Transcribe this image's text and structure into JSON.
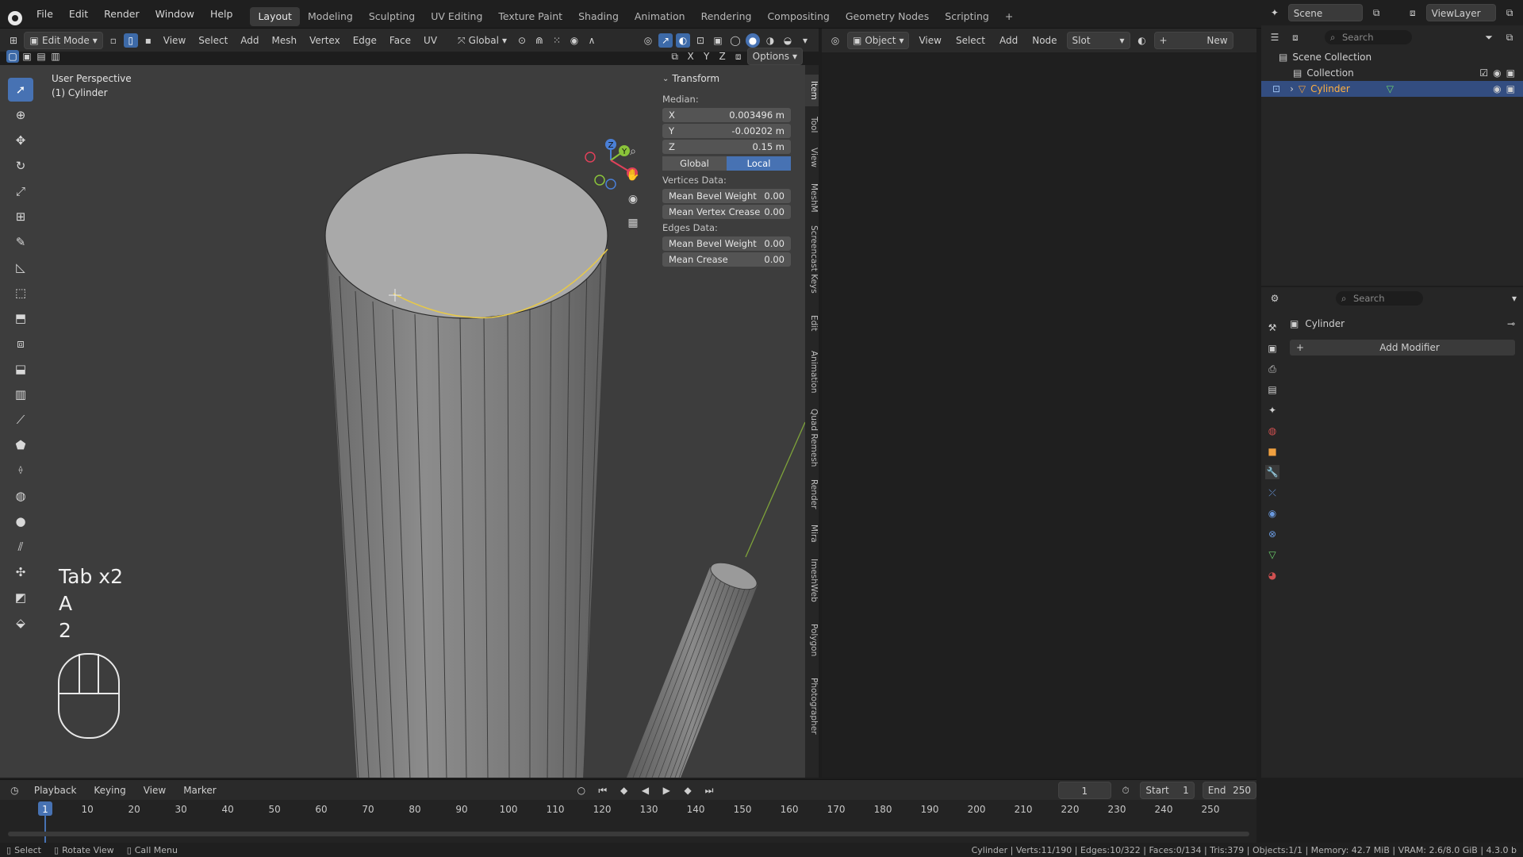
{
  "topbar": {
    "menus": [
      "File",
      "Edit",
      "Render",
      "Window",
      "Help"
    ],
    "workspaces": [
      "Layout",
      "Modeling",
      "Sculpting",
      "UV Editing",
      "Texture Paint",
      "Shading",
      "Animation",
      "Rendering",
      "Compositing",
      "Geometry Nodes",
      "Scripting"
    ],
    "active_workspace": "Layout",
    "scene": "Scene",
    "view_layer": "ViewLayer"
  },
  "viewport_header": {
    "mode": "Edit Mode",
    "menus": [
      "View",
      "Select",
      "Add",
      "Mesh",
      "Vertex",
      "Edge",
      "Face",
      "UV"
    ],
    "orientation": "Global",
    "options": "Options",
    "axes": [
      "X",
      "Y",
      "Z"
    ]
  },
  "viewport": {
    "view_name": "User Perspective",
    "object_name": "(1) Cylinder",
    "gizmo_labels": [
      "Z",
      "Y",
      "X"
    ],
    "keys": [
      "Tab x2",
      "A",
      "2"
    ]
  },
  "transform_panel": {
    "title": "Transform",
    "median_label": "Median:",
    "fields": [
      {
        "label": "X",
        "value": "0.003496 m"
      },
      {
        "label": "Y",
        "value": "-0.00202 m"
      },
      {
        "label": "Z",
        "value": "0.15 m"
      }
    ],
    "space_options": [
      "Global",
      "Local"
    ],
    "active_space": "Local",
    "vertices_label": "Vertices Data:",
    "vertex_fields": [
      {
        "label": "Mean Bevel Weight",
        "value": "0.00"
      },
      {
        "label": "Mean Vertex Crease",
        "value": "0.00"
      }
    ],
    "edges_label": "Edges Data:",
    "edge_fields": [
      {
        "label": "Mean Bevel Weight",
        "value": "0.00"
      },
      {
        "label": "Mean Crease",
        "value": "0.00"
      }
    ]
  },
  "sidebar_tabs": [
    "Item",
    "Tool",
    "View",
    "MeshM",
    "Screencast Keys",
    "Edit",
    "Animation",
    "Quad Remesh",
    "Render",
    "Mira",
    "ImeshWeb",
    "Polygon",
    "Photographer"
  ],
  "node_header": {
    "object": "Object",
    "menus": [
      "View",
      "Select",
      "Add",
      "Node"
    ],
    "slot": "Slot",
    "new_label": "New"
  },
  "outliner": {
    "search_placeholder": "Search",
    "scene_collection": "Scene Collection",
    "collection": "Collection",
    "object": "Cylinder"
  },
  "properties": {
    "search_placeholder": "Search",
    "object": "Cylinder",
    "add_modifier": "Add Modifier"
  },
  "timeline": {
    "menus": [
      "Playback",
      "Keying",
      "View",
      "Marker"
    ],
    "current_frame": "1",
    "start_label": "Start",
    "start": "1",
    "end_label": "End",
    "end": "250",
    "ticks": [
      "1",
      "10",
      "20",
      "30",
      "40",
      "50",
      "60",
      "70",
      "80",
      "90",
      "100",
      "110",
      "120",
      "130",
      "140",
      "150",
      "160",
      "170",
      "180",
      "190",
      "200",
      "210",
      "220",
      "230",
      "240",
      "250"
    ]
  },
  "statusbar": {
    "left": [
      "Select",
      "Rotate View",
      "Call Menu"
    ],
    "right": "Cylinder | Verts:11/190 | Edges:10/322 | Faces:0/134 | Tris:379 | Objects:1/1 | Memory: 42.7 MiB | VRAM: 2.6/8.0 GiB | 4.3.0 b"
  }
}
